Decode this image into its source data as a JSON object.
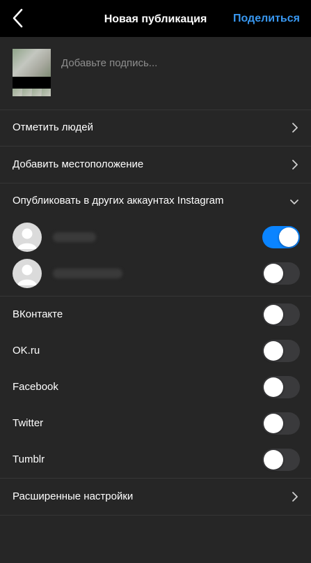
{
  "header": {
    "title": "Новая публикация",
    "share_label": "Поделиться"
  },
  "caption": {
    "placeholder": "Добавьте подпись..."
  },
  "menu": {
    "tag_people": "Отметить людей",
    "add_location": "Добавить местоположение",
    "other_accounts": "Опубликовать в других аккаунтах Instagram",
    "advanced": "Расширенные настройки"
  },
  "accounts": [
    {
      "enabled": true
    },
    {
      "enabled": false
    }
  ],
  "share_targets": [
    {
      "label": "ВКонтакте",
      "enabled": false
    },
    {
      "label": "OK.ru",
      "enabled": false
    },
    {
      "label": "Facebook",
      "enabled": false
    },
    {
      "label": "Twitter",
      "enabled": false
    },
    {
      "label": "Tumblr",
      "enabled": false
    }
  ],
  "colors": {
    "accent": "#3897f0",
    "toggle_on": "#0a84ff",
    "background": "#262626",
    "header_bg": "#000000"
  }
}
